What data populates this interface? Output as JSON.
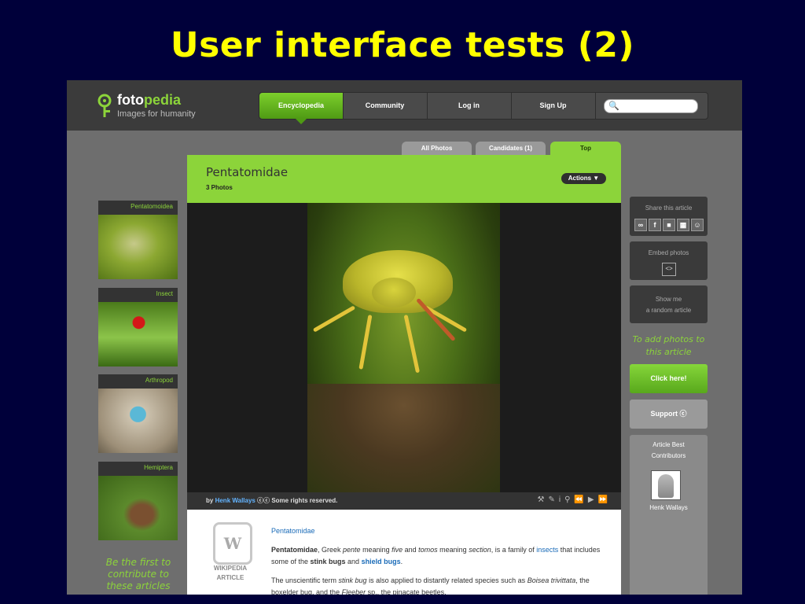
{
  "slide": {
    "title": "User interface tests (2)"
  },
  "brand": {
    "name_prefix": "foto",
    "name_suffix": "pedia",
    "tagline": "Images for humanity"
  },
  "nav": {
    "items": [
      "Encyclopedia",
      "Community",
      "Log in",
      "Sign Up"
    ],
    "active": "Encyclopedia",
    "search_placeholder": ""
  },
  "tabs": [
    "All Photos",
    "Candidates (1)",
    "Top"
  ],
  "article": {
    "title": "Pentatomidae",
    "photo_count": "3 Photos",
    "actions_label": "Actions ▼"
  },
  "photo_credit": {
    "by": "by",
    "author": "Henk Wallays",
    "rights": "Some rights reserved."
  },
  "thumbnails": [
    "Pentatomoidea",
    "Insect",
    "Arthropod",
    "Hemiptera"
  ],
  "be_first": "Be the first to contribute to these articles",
  "sidebar": {
    "share_title": "Share this article",
    "embed_title": "Embed photos",
    "random_line1": "Show me",
    "random_line2": "a random article",
    "add_photos": "To add photos to this article",
    "click_here": "Click here!",
    "support": "Support",
    "contributors_title1": "Article Best",
    "contributors_title2": "Contributors",
    "contributor_name": "Henk Wallays"
  },
  "wiki": {
    "label1": "WIKIPEDIA",
    "label2": "ARTICLE",
    "title": "Pentatomidae",
    "p1_bold": "Pentatomidae",
    "p1_a": ", Greek ",
    "p1_pente": "pente",
    "p1_b": " meaning ",
    "p1_five": "five",
    "p1_c": " and ",
    "p1_tomos": "tomos",
    "p1_d": " meaning ",
    "p1_section": "section",
    "p1_e": ", is a family of ",
    "p1_insects": "insects",
    "p1_f": " that includes some of the ",
    "p1_stink": "stink bugs",
    "p1_g": " and ",
    "p1_shield": "shield bugs",
    "p1_h": ".",
    "p2_a": "The unscientific term ",
    "p2_stinkbug": "stink bug",
    "p2_b": " is also applied to distantly related species such as ",
    "p2_boisea": "Boisea trivittata",
    "p2_c": ", the boxelder bug, and the ",
    "p2_fleeber": "Fleeber",
    "p2_d": " sp., the pinacate beetles."
  },
  "colors": {
    "accent": "#8cd43a",
    "slide_bg": "#00003a",
    "title": "#ffff00"
  }
}
